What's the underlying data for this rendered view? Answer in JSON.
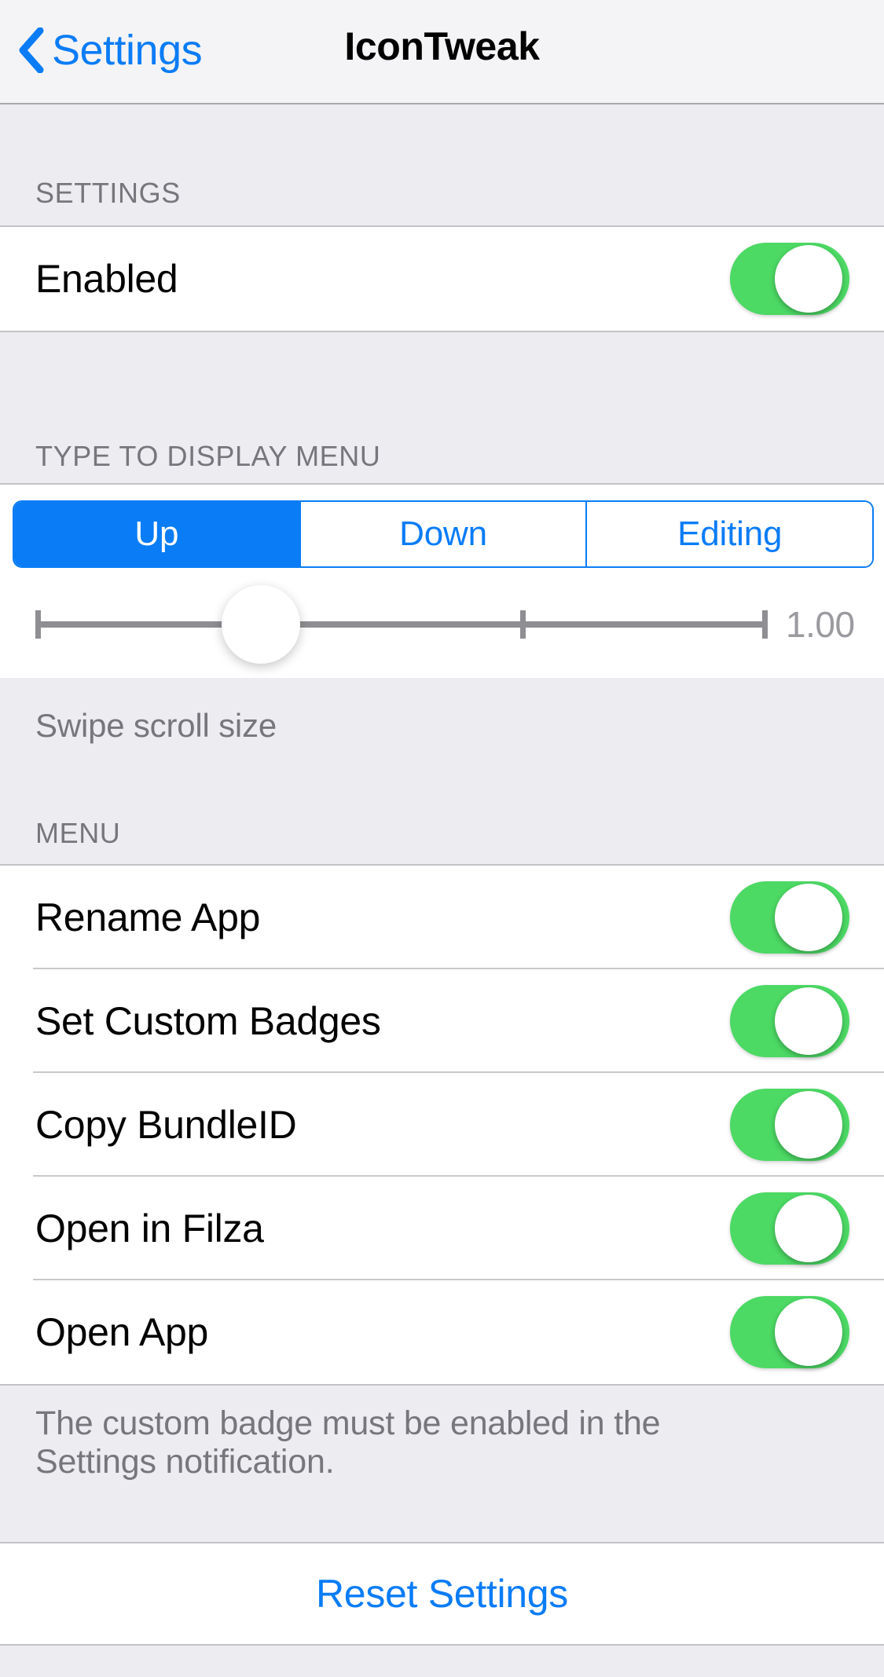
{
  "navbar": {
    "back_label": "Settings",
    "back_icon": "chevron-left-icon",
    "title": "IconTweak"
  },
  "sections": {
    "settings": {
      "header": "SETTINGS",
      "rows": [
        {
          "label": "Enabled",
          "toggle": "on"
        }
      ]
    },
    "type_to_display_menu": {
      "header": "TYPE TO DISPLAY MENU",
      "segmented": {
        "options": [
          "Up",
          "Down",
          "Editing"
        ],
        "selected_index": 0,
        "selected_value": "Up"
      },
      "slider": {
        "value_label": "1.00",
        "value": 1.0,
        "knob_percent": 23,
        "ticks": 3
      },
      "footer": "Swipe scroll size"
    },
    "menu": {
      "header": "MENU",
      "rows": [
        {
          "label": "Rename App",
          "toggle": "on"
        },
        {
          "label": "Set Custom Badges",
          "toggle": "on"
        },
        {
          "label": "Copy BundleID",
          "toggle": "on"
        },
        {
          "label": "Open in Filza",
          "toggle": "on"
        },
        {
          "label": "Open App",
          "toggle": "on"
        }
      ],
      "footer": "The custom badge must be enabled in the Settings notification."
    },
    "reset": {
      "label": "Reset Settings"
    }
  },
  "colors": {
    "accent_blue": "#0a7cf6",
    "toggle_green": "#4cd964",
    "group_background": "#ededf1",
    "cell_background": "#ffffff",
    "secondary_text": "#76767c"
  }
}
